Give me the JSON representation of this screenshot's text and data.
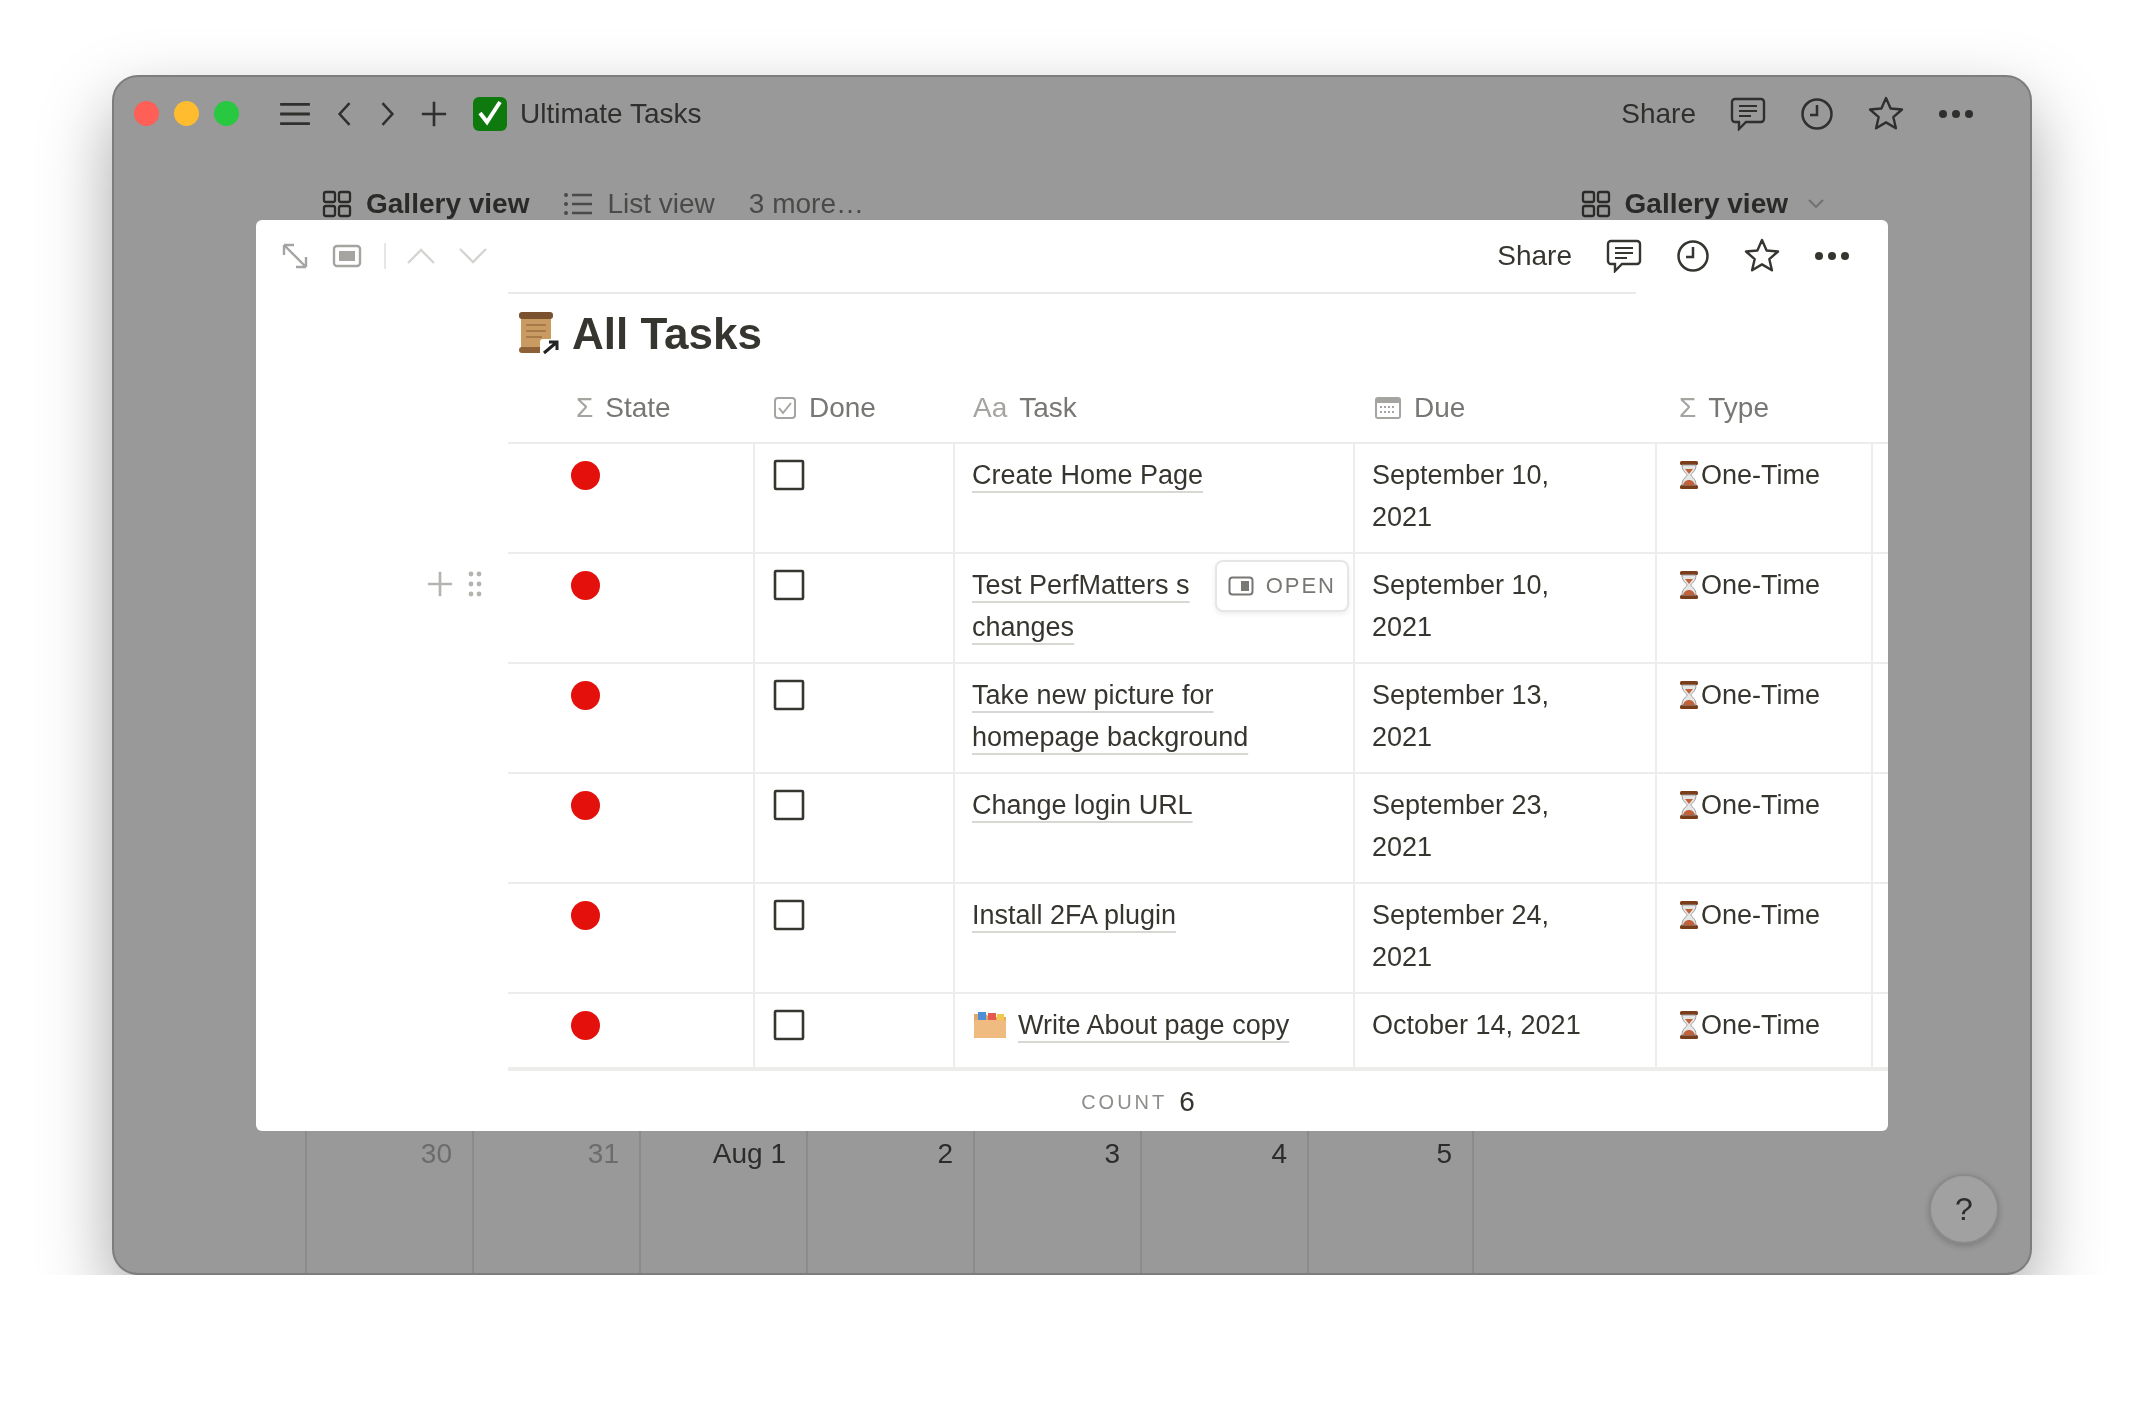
{
  "window": {
    "title": "Ultimate Tasks",
    "share": "Share"
  },
  "views": [
    {
      "label": "Gallery view",
      "kind": "gallery",
      "selected": true
    },
    {
      "label": "List view",
      "kind": "list",
      "selected": false
    },
    {
      "label": "3 more…",
      "kind": "more",
      "selected": false
    }
  ],
  "view_switcher": {
    "label": "Gallery view"
  },
  "peek": {
    "share": "Share",
    "title": "All Tasks",
    "columns": [
      {
        "label": "State",
        "kind": "formula",
        "glyph": "Σ"
      },
      {
        "label": "Done",
        "kind": "checkbox"
      },
      {
        "label": "Task",
        "kind": "title",
        "glyph": "Aa"
      },
      {
        "label": "Due",
        "kind": "date"
      },
      {
        "label": "Type",
        "kind": "formula",
        "glyph": "Σ"
      }
    ],
    "open_label": "OPEN",
    "rows": [
      {
        "color": "#e3100c",
        "done": false,
        "task": "Create Home Page",
        "kind": "page",
        "due": "September 10, 2021",
        "type": "One-Time",
        "hovered": false
      },
      {
        "color": "#e3100c",
        "done": false,
        "task": "Test PerfMatters s changes",
        "kind": "page",
        "due": "September 10, 2021",
        "type": "One-Time",
        "hovered": true
      },
      {
        "color": "#e3100c",
        "done": false,
        "task": "Take new picture for homepage background",
        "kind": "page",
        "due": "September 13, 2021",
        "type": "One-Time",
        "hovered": false
      },
      {
        "color": "#e3100c",
        "done": false,
        "task": "Change login URL",
        "kind": "page",
        "due": "September 23, 2021",
        "type": "One-Time",
        "hovered": false
      },
      {
        "color": "#e3100c",
        "done": false,
        "task": "Install 2FA plugin",
        "kind": "page",
        "due": "September 24, 2021",
        "type": "One-Time",
        "hovered": false
      },
      {
        "color": "#e3100c",
        "done": false,
        "task": "Write About page copy",
        "kind": "page-with-icon",
        "due": "October 14, 2021",
        "type": "One-Time",
        "hovered": false
      }
    ],
    "count_label": "COUNT",
    "count": "6"
  },
  "calendar": {
    "days": [
      {
        "label": "30",
        "muted": true
      },
      {
        "label": "31",
        "muted": true
      },
      {
        "label": "Aug 1",
        "muted": false
      },
      {
        "label": "2",
        "muted": false
      },
      {
        "label": "3",
        "muted": false
      },
      {
        "label": "4",
        "muted": false
      },
      {
        "label": "5",
        "muted": false
      }
    ]
  },
  "help": "?"
}
